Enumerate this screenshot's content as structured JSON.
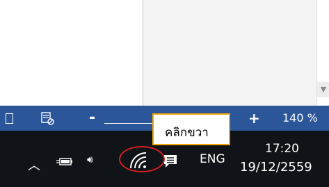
{
  "statusbar": {
    "zoom_minus": "-",
    "zoom_plus": "+",
    "zoom_level": "140 %",
    "zoom_percent_value": 140
  },
  "taskbar": {
    "language": "ENG",
    "time": "17:20",
    "date": "19/12/2559"
  },
  "callout": {
    "text": "คลิกขวา",
    "border_color": "#f0a30a"
  },
  "highlight": {
    "circle_color": "#d81e1e",
    "target_icon": "wifi-icon"
  },
  "colors": {
    "statusbar_bg": "#2b579a",
    "taskbar_bg": "#101317"
  }
}
